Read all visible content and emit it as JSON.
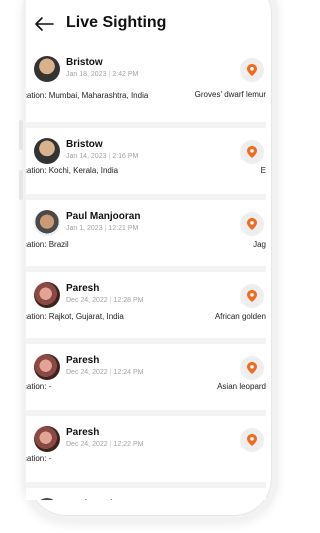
{
  "header": {
    "back_icon": "arrow-left-icon",
    "title": "Live Sighting"
  },
  "colors": {
    "accent": "#f26b1d",
    "background": "#f3f3f3",
    "card": "#ffffff",
    "meta_text": "#a3a3a3"
  },
  "sightings": [
    {
      "name": "Bristow",
      "date": "Jan 18, 2023",
      "time": "2:42 PM",
      "location": "Location: Mumbai, Maharashtra, India",
      "animal": "Groves' dwarf lemur",
      "avatar": "male"
    },
    {
      "name": "Bristow",
      "date": "Jan 14, 2023",
      "time": "2:16 PM",
      "location": "Location: Kochi, Kerala, India",
      "animal": "E",
      "avatar": "male"
    },
    {
      "name": "Paul Manjooran",
      "date": "Jan 1, 2023",
      "time": "12:21 PM",
      "location": "Location: Brazil",
      "animal": "Jag",
      "avatar": "male2"
    },
    {
      "name": "Paresh",
      "date": "Dec 24, 2022",
      "time": "12:28 PM",
      "location": "Location: Rajkot, Gujarat, India",
      "animal": "African golden",
      "avatar": "female"
    },
    {
      "name": "Paresh",
      "date": "Dec 24, 2022",
      "time": "12:24 PM",
      "location": "Location: -",
      "animal": "Asian leopard",
      "avatar": "female"
    },
    {
      "name": "Paresh",
      "date": "Dec 24, 2022",
      "time": "12:22 PM",
      "location": "Location: -",
      "animal": "",
      "avatar": "female"
    },
    {
      "name": "Paul Manjooran",
      "date": "",
      "time": "",
      "location": "",
      "animal": "",
      "avatar": "male2"
    }
  ]
}
